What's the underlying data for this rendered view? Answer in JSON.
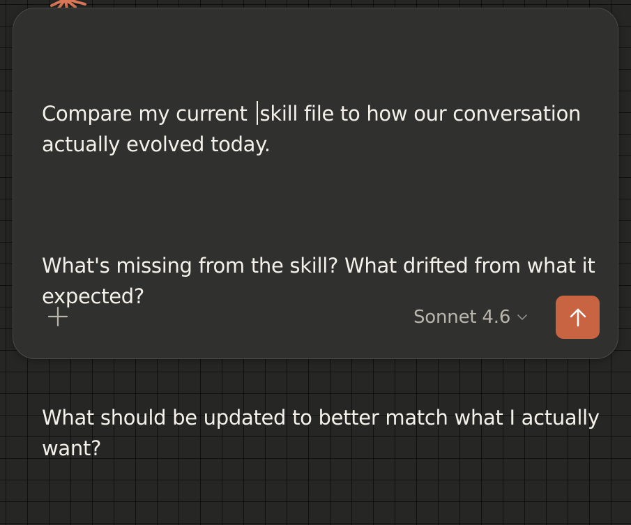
{
  "composer": {
    "paragraphs": [
      {
        "before_cursor": "Compare my current ",
        "after_cursor": "skill file to how our conversation actually evolved today."
      },
      {
        "text": "What's missing from the skill? What drifted from what it expected?"
      },
      {
        "text": "What should be updated to better match what I actually want?"
      }
    ],
    "model_label": "Sonnet 4.6",
    "add_icon": "plus-icon",
    "send_icon": "arrow-up-icon",
    "chevron_icon": "chevron-down-icon",
    "logo_icon": "starburst-logo-icon"
  },
  "colors": {
    "background": "#262624",
    "panel": "#30302e",
    "text": "#f3f1ea",
    "muted_text": "#b9b6ae",
    "accent": "#c96442",
    "logo": "#d97757"
  }
}
